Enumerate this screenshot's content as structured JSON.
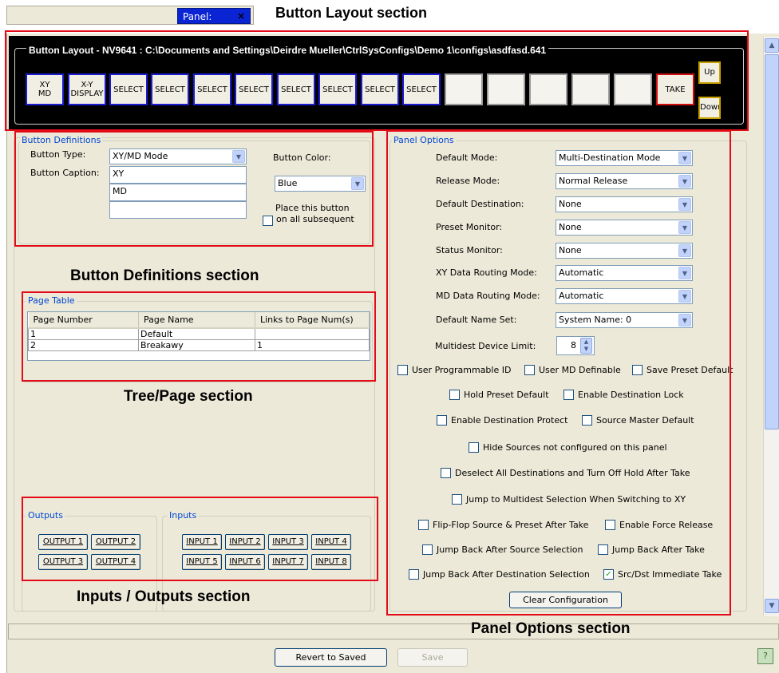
{
  "tab": {
    "label": "Panel:",
    "close": "×"
  },
  "callouts": {
    "button_layout": "Button Layout section",
    "button_definitions": "Button Definitions section",
    "tree_page": "Tree/Page section",
    "inputs_outputs": "Inputs / Outputs section",
    "panel_options": "Panel Options  section"
  },
  "colors": {
    "callout_border": "#e30b17",
    "layout_background": "#000000",
    "button_border": "#1b1bd0",
    "legend_text": "#0046d5"
  },
  "button_layout": {
    "title": "Button Layout - NV9641 : C:\\Documents and Settings\\Deirdre Mueller\\CtrlSysConfigs\\Demo 1\\configs\\asdfasd.641",
    "buttons": [
      "XY\nMD",
      "X-Y\nDISPLAY",
      "SELECT",
      "SELECT",
      "SELECT",
      "SELECT",
      "SELECT",
      "SELECT",
      "SELECT",
      "SELECT",
      "",
      "",
      "",
      "",
      "",
      "TAKE"
    ],
    "up": "Up",
    "down": "Down"
  },
  "button_definitions": {
    "legend": "Button Definitions",
    "type_label": "Button Type:",
    "type_value": "XY/MD Mode",
    "caption_label": "Button Caption:",
    "caption_lines": [
      "XY",
      "MD",
      ""
    ],
    "color_label": "Button Color:",
    "color_value": "Blue",
    "place_line1": "Place this button",
    "place_line2": "on all subsequent"
  },
  "page_table": {
    "legend": "Page Table",
    "columns": [
      "Page Number",
      "Page Name",
      "Links to Page Num(s)"
    ],
    "rows": [
      [
        "1",
        "Default",
        ""
      ],
      [
        "2",
        "Breakawy",
        "1"
      ]
    ]
  },
  "outputs": {
    "legend": "Outputs",
    "buttons": [
      "OUTPUT 1",
      "OUTPUT 2",
      "OUTPUT 3",
      "OUTPUT 4"
    ]
  },
  "inputs": {
    "legend": "Inputs",
    "buttons": [
      "INPUT 1",
      "INPUT 2",
      "INPUT 3",
      "INPUT 4",
      "INPUT 5",
      "INPUT 6",
      "INPUT 7",
      "INPUT 8"
    ]
  },
  "panel_options": {
    "legend": "Panel Options",
    "fields": [
      {
        "label": "Default Mode:",
        "value": "Multi-Destination Mode"
      },
      {
        "label": "Release Mode:",
        "value": "Normal Release"
      },
      {
        "label": "Default Destination:",
        "value": "None"
      },
      {
        "label": "Preset Monitor:",
        "value": "None"
      },
      {
        "label": "Status Monitor:",
        "value": "None"
      },
      {
        "label": "XY Data Routing Mode:",
        "value": "Automatic"
      },
      {
        "label": "MD Data Routing Mode:",
        "value": "Automatic"
      },
      {
        "label": "Default Name Set:",
        "value": "System Name: 0"
      }
    ],
    "limit_label": "Multidest Device Limit:",
    "limit_value": "8",
    "checkboxes": {
      "user_programmable_id": "User Programmable ID",
      "user_md_definable": "User MD Definable",
      "save_preset_default": "Save Preset Default",
      "hold_preset_default": "Hold Preset Default",
      "enable_destination_lock": "Enable Destination Lock",
      "enable_destination_protect": "Enable Destination Protect",
      "source_master_default": "Source Master Default",
      "hide_sources": "Hide Sources not configured on this panel",
      "deselect_all": "Deselect All Destinations and Turn Off Hold After Take",
      "jump_to_multidest": "Jump to Multidest Selection When Switching to XY",
      "flip_flop": "Flip-Flop Source & Preset After Take",
      "enable_force_release": "Enable Force Release",
      "jump_back_source": "Jump Back After Source Selection",
      "jump_back_take": "Jump Back After Take",
      "jump_back_destination": "Jump Back After Destination Selection",
      "src_dst_immediate_take": "Src/Dst Immediate Take"
    },
    "checked": "✓",
    "clear": "Clear Configuration"
  },
  "footer": {
    "revert": "Revert to Saved",
    "save": "Save",
    "help": "?"
  }
}
